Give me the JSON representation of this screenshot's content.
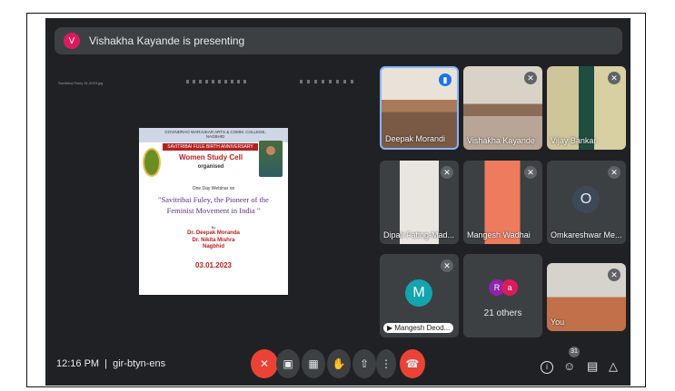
{
  "presenting": {
    "avatar_letter": "V",
    "text": "Vishakha Kayande is presenting"
  },
  "share": {
    "file_name": "Savitribai Fuley 01.2023.jpg",
    "zoom": "139%",
    "poster": {
      "college": "GOVINDRAO WARJUKAR ARTS & COMM. COLLEGE, NAGBHID",
      "anniversary": "SAVITRIBAI FULE BIRTH ANNIVERSARY",
      "cell": "Women Study Cell",
      "organised": "organised",
      "webinar": "One Day Webinar on",
      "topic": "\"Savitribai Fuley, the Pioneer of the Feminist Movement in India \"",
      "by": "By",
      "speakers": "Dr. Deepak Moranda\nDr. Nikita Mishra\nNagbhid",
      "date": "03.01.2023"
    }
  },
  "participants": [
    {
      "name": "Deepak Morandi"
    },
    {
      "name": "Vishakha Kayande"
    },
    {
      "name": "Vijay Bankar"
    },
    {
      "name": "Dipali Fating-Mad..."
    },
    {
      "name": "Mangesh Wadhai"
    },
    {
      "name": "Omkareshwar Me...",
      "letter": "O"
    },
    {
      "name": "Mangesh Deod...",
      "letter": "M"
    },
    {
      "name": "21 others",
      "letters": [
        "R",
        "a"
      ]
    },
    {
      "name": "You"
    }
  ],
  "bottom": {
    "time": "12:16 PM",
    "separator": "|",
    "code": "gir-btyn-ens",
    "people_count": "31"
  },
  "colors": {
    "end_call": "#ea4335",
    "mic_off": "#ea4335",
    "bg": "#202124",
    "tile": "#3c4043"
  }
}
